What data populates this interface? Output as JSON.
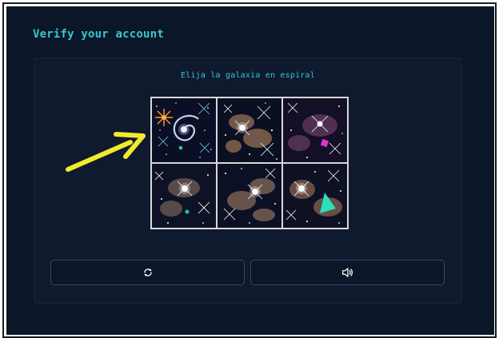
{
  "page": {
    "title": "Verify your account"
  },
  "captcha": {
    "instruction": "Elija la galaxia en espiral",
    "tiles": [
      {
        "content": "spiral galaxy with orange star"
      },
      {
        "content": "star field"
      },
      {
        "content": "star field with magenta object"
      },
      {
        "content": "star field with green dot"
      },
      {
        "content": "star field"
      },
      {
        "content": "star field with teal triangle"
      }
    ],
    "refresh_icon": "refresh-icon",
    "audio_icon": "speaker-icon"
  },
  "annotation": {
    "arrow_color": "#f2ea2d"
  },
  "colors": {
    "background": "#0c1629",
    "accent": "#38c6cf",
    "tile_border": "#d8d8d8"
  }
}
